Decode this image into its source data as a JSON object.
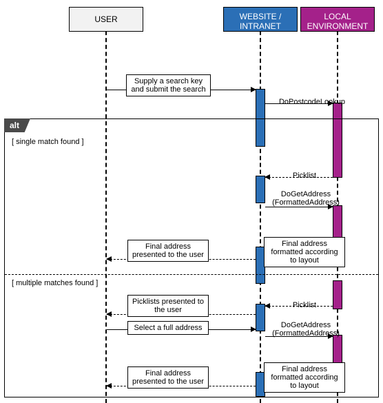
{
  "participants": {
    "user": "USER",
    "website": "WEBSITE / INTRANET",
    "local": "LOCAL ENVIRONMENT"
  },
  "messages": {
    "m1": "Supply a search key and submit the search",
    "m2": "DoPostcodeLookup",
    "m3": "Picklist",
    "m4": "DoGetAddress (FormattedAddress)",
    "m5": "Final address formatted according to layout",
    "m6": "Final address presented to the user",
    "m7": "Picklist",
    "m8": "Picklists presented to the user",
    "m9": "Select a full address",
    "m10": "DoGetAddress (FormattedAddress)",
    "m11": "Final address formatted according to layout",
    "m12": "Final address presented to the user"
  },
  "frame": {
    "alt": "alt",
    "guard1": "[ single match found ]",
    "guard2": "[ multiple matches found ]"
  },
  "colors": {
    "user_bg": "#F2F2F2",
    "website_bg": "#2B6FB6",
    "local_bg": "#A4218A"
  },
  "chart_data": {
    "type": "sequence-diagram",
    "participants": [
      "USER",
      "WEBSITE / INTRANET",
      "LOCAL ENVIRONMENT"
    ],
    "interactions": [
      {
        "from": "USER",
        "to": "WEBSITE / INTRANET",
        "label": "Supply a search key and submit the search",
        "type": "sync"
      },
      {
        "from": "WEBSITE / INTRANET",
        "to": "LOCAL ENVIRONMENT",
        "label": "DoPostcodeLookup",
        "type": "sync"
      }
    ],
    "frame": {
      "type": "alt",
      "sections": [
        {
          "guard": "[ single match found ]",
          "interactions": [
            {
              "from": "LOCAL ENVIRONMENT",
              "to": "WEBSITE / INTRANET",
              "label": "Picklist",
              "type": "return"
            },
            {
              "from": "WEBSITE / INTRANET",
              "to": "LOCAL ENVIRONMENT",
              "label": "DoGetAddress (FormattedAddress)",
              "type": "sync"
            },
            {
              "from": "LOCAL ENVIRONMENT",
              "to": "WEBSITE / INTRANET",
              "label": "Final address formatted according to layout",
              "type": "return"
            },
            {
              "from": "WEBSITE / INTRANET",
              "to": "USER",
              "label": "Final address presented to the user",
              "type": "return"
            }
          ]
        },
        {
          "guard": "[ multiple matches found ]",
          "interactions": [
            {
              "from": "LOCAL ENVIRONMENT",
              "to": "WEBSITE / INTRANET",
              "label": "Picklist",
              "type": "return"
            },
            {
              "from": "WEBSITE / INTRANET",
              "to": "USER",
              "label": "Picklists presented to the user",
              "type": "return"
            },
            {
              "from": "USER",
              "to": "WEBSITE / INTRANET",
              "label": "Select a full address",
              "type": "sync"
            },
            {
              "from": "WEBSITE / INTRANET",
              "to": "LOCAL ENVIRONMENT",
              "label": "DoGetAddress (FormattedAddress)",
              "type": "sync"
            },
            {
              "from": "LOCAL ENVIRONMENT",
              "to": "WEBSITE / INTRANET",
              "label": "Final address formatted according to layout",
              "type": "return"
            },
            {
              "from": "WEBSITE / INTRANET",
              "to": "USER",
              "label": "Final address presented to the user",
              "type": "return"
            }
          ]
        }
      ]
    }
  }
}
